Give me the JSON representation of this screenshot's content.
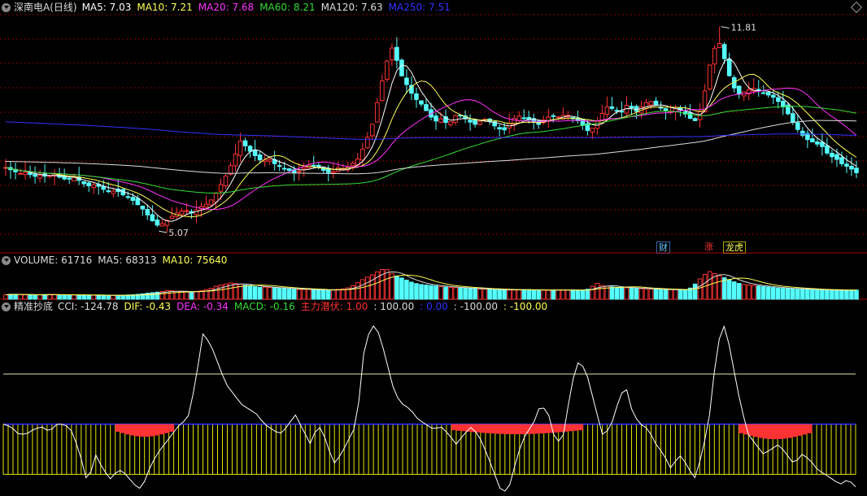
{
  "header": {
    "stock_name": "深南电A(日线)",
    "ma": [
      {
        "label": "MA5: 7.03",
        "color": "#ffffff"
      },
      {
        "label": "MA10: 7.21",
        "color": "#ffff55"
      },
      {
        "label": "MA20: 7.68",
        "color": "#ff33ff"
      },
      {
        "label": "MA60: 8.21",
        "color": "#33dd33"
      },
      {
        "label": "MA120: 7.63",
        "color": "#dddddd"
      },
      {
        "label": "MA250: 7.51",
        "color": "#3333ff"
      }
    ]
  },
  "volume_header": {
    "items": [
      {
        "label": "VOLUME: 61716",
        "color": "#dddddd"
      },
      {
        "label": "MA5: 68313",
        "color": "#dddddd"
      },
      {
        "label": "MA10: 75640",
        "color": "#ffff55"
      }
    ]
  },
  "indicator_header": {
    "name": "精准抄底",
    "items": [
      {
        "label": "CCI: -124.78",
        "color": "#dddddd"
      },
      {
        "label": "DIF: -0.43",
        "color": "#ffff55"
      },
      {
        "label": "DEA: -0.34",
        "color": "#ff33ff"
      },
      {
        "label": "MACD: -0.16",
        "color": "#33dd33"
      },
      {
        "label": "主力潜伏: 1.00",
        "color": "#ff3333"
      },
      {
        "label": ": 100.00",
        "color": "#dddddd"
      },
      {
        "label": ": 0.00",
        "color": "#3333ff"
      },
      {
        "label": ": -100.00",
        "color": "#dddddd"
      },
      {
        "label": ": -100.00",
        "color": "#ffff55"
      }
    ]
  },
  "annotations": {
    "high_label": "11.81",
    "low_label": "5.07",
    "flags": [
      {
        "text": "财",
        "color": "#66ccff"
      },
      {
        "text": "涨",
        "color": "#ff3333"
      },
      {
        "text": "龙虎",
        "color": "#ffff55"
      }
    ]
  },
  "colors": {
    "up": "#ff3333",
    "down": "#55ffff",
    "grid": "#8b0000",
    "ma5": "#ffffff",
    "ma10": "#ffff55",
    "ma20": "#ff33ff",
    "ma60": "#33dd33",
    "ma120": "#dddddd",
    "ma250": "#3333ff"
  },
  "chart_data": {
    "type": "candlestick",
    "price_range": [
      4.7,
      12.2
    ],
    "high": 11.81,
    "low": 5.07,
    "close_path": [
      7.2,
      7.1,
      7.0,
      7.05,
      6.9,
      6.95,
      6.9,
      7.0,
      6.85,
      6.8,
      6.9,
      6.7,
      6.6,
      6.65,
      6.5,
      6.4,
      6.45,
      6.3,
      6.2,
      6.0,
      5.8,
      5.5,
      5.3,
      5.4,
      5.6,
      5.75,
      5.8,
      5.7,
      5.9,
      6.0,
      6.2,
      6.6,
      7.0,
      7.5,
      8.1,
      7.8,
      7.6,
      7.4,
      7.5,
      7.3,
      7.2,
      7.1,
      7.0,
      7.2,
      7.3,
      7.25,
      7.1,
      7.0,
      7.2,
      7.15,
      7.3,
      7.5,
      8.0,
      8.6,
      9.6,
      10.6,
      11.2,
      10.3,
      9.9,
      9.5,
      9.3,
      9.0,
      8.7,
      8.8,
      8.6,
      8.9,
      8.9,
      8.7,
      8.6,
      8.8,
      8.7,
      8.5,
      8.4,
      8.7,
      8.9,
      8.8,
      8.75,
      8.6,
      8.8,
      8.9,
      8.85,
      8.95,
      8.8,
      8.7,
      8.4,
      8.5,
      8.9,
      9.2,
      9.1,
      9.0,
      9.3,
      9.0,
      9.2,
      9.4,
      9.25,
      9.1,
      9.0,
      9.2,
      9.0,
      8.8,
      8.7,
      9.6,
      10.8,
      11.4,
      10.7,
      9.9,
      9.6,
      9.7,
      9.8,
      9.7,
      9.6,
      9.5,
      9.3,
      9.0,
      8.6,
      8.3,
      8.1,
      8.0,
      7.9,
      7.6,
      7.5,
      7.3,
      7.2,
      7.03
    ],
    "volume_range": [
      0,
      220000
    ],
    "volume_path": [
      30,
      35,
      32,
      30,
      28,
      30,
      33,
      31,
      29,
      30,
      28,
      27,
      26,
      28,
      27,
      25,
      26,
      28,
      30,
      34,
      40,
      45,
      50,
      60,
      55,
      50,
      48,
      52,
      60,
      70,
      90,
      100,
      110,
      105,
      95,
      90,
      80,
      82,
      78,
      75,
      70,
      68,
      65,
      66,
      64,
      62,
      60,
      65,
      70,
      80,
      110,
      140,
      160,
      190,
      210,
      170,
      150,
      130,
      110,
      100,
      95,
      90,
      85,
      80,
      78,
      75,
      72,
      70,
      68,
      66,
      64,
      63,
      62,
      64,
      66,
      63,
      61,
      60,
      62,
      64,
      63,
      61,
      60,
      70,
      110,
      90,
      85,
      80,
      78,
      75,
      72,
      70,
      68,
      65,
      64,
      66,
      63,
      62,
      100,
      150,
      190,
      170,
      150,
      130,
      110,
      100,
      95,
      90,
      85,
      80,
      75,
      72,
      70,
      68,
      66,
      64,
      62,
      61,
      62,
      60,
      62,
      61.7
    ]
  },
  "indicator_data": {
    "cci_range": [
      -140,
      220
    ],
    "levels": {
      "upper": 100,
      "zero": 0,
      "lower": -100
    },
    "cci_path": [
      0,
      -5,
      -20,
      -20,
      -10,
      -5,
      -15,
      0,
      0,
      -15,
      -60,
      -120,
      -60,
      -90,
      -110,
      -90,
      -100,
      -120,
      -130,
      -90,
      -60,
      -40,
      -20,
      0,
      10,
      80,
      180,
      160,
      120,
      80,
      60,
      40,
      30,
      20,
      0,
      -10,
      -20,
      -5,
      20,
      -10,
      -40,
      0,
      -30,
      -80,
      -60,
      -30,
      0,
      150,
      200,
      180,
      120,
      60,
      40,
      30,
      10,
      0,
      -10,
      -5,
      -20,
      -40,
      -20,
      -5,
      -25,
      -60,
      -100,
      -140,
      -120,
      -60,
      -20,
      0,
      40,
      20,
      -40,
      -20,
      80,
      130,
      100,
      40,
      -20,
      -10,
      40,
      80,
      20,
      0,
      -10,
      -40,
      -60,
      -90,
      -60,
      -80,
      -110,
      -60,
      20,
      160,
      200,
      120,
      40,
      -20,
      -40,
      -60,
      -50,
      -40,
      -60,
      -80,
      -60,
      -70,
      -90,
      -100,
      -110,
      -120,
      -110,
      -124.78
    ],
    "red_bars": [
      {
        "from": 23,
        "to": 34,
        "depth": -25
      },
      {
        "from": 92,
        "to": 118,
        "depth": -20
      },
      {
        "from": 151,
        "to": 165,
        "depth": -30
      }
    ]
  }
}
